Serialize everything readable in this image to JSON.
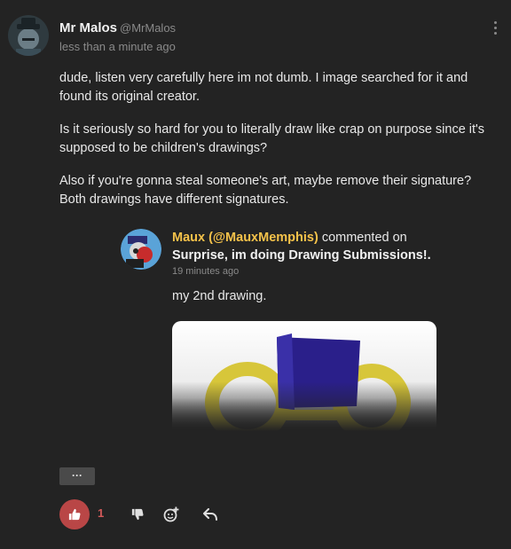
{
  "post": {
    "author_name": "Mr Malos",
    "author_handle": "@MrMalos",
    "timestamp": "less than a minute ago",
    "paragraphs": [
      "dude, listen very carefully here im not dumb. I image searched for it and found its original creator.",
      "Is it seriously so hard for you to literally draw like crap on purpose since it's supposed to be children's drawings?",
      "Also if you're gonna steal someone's art, maybe remove their signature? Both drawings have different signatures."
    ]
  },
  "embed": {
    "user": "Maux (@MauxMemphis)",
    "action": " commented on",
    "title": "Surprise, im doing Drawing Submissions!.",
    "timestamp": "19 minutes ago",
    "text": "my 2nd drawing."
  },
  "actions": {
    "more_label": "···",
    "like_count": "1"
  },
  "colors": {
    "background": "#232323",
    "accent_user": "#f5c24a",
    "like_button": "#b94646",
    "like_count": "#d35a5a"
  },
  "icons": {
    "like": "thumbs-up-icon",
    "dislike": "thumbs-down-icon",
    "react": "add-reaction-icon",
    "reply": "reply-arrow-icon",
    "menu": "kebab-menu-icon"
  }
}
